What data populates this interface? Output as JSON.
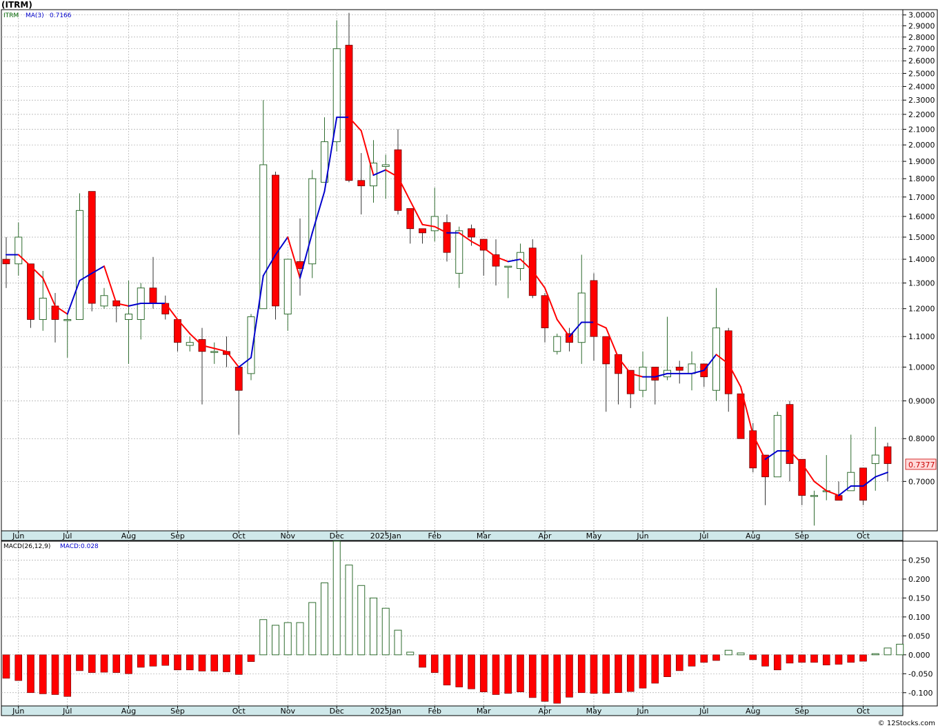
{
  "title": "(ITRM)",
  "credit": "© 12Stocks.com",
  "colors": {
    "up": "#2e6b2e",
    "down": "#ff0000",
    "down_wick": "#333333",
    "ma_up": "#0000cc",
    "ma_down": "#ff0000",
    "grid": "#aaaaaa",
    "axis_band": "#cfe8ea",
    "last_label_bg": "#ffd9d9",
    "last_label_fg": "#cc0000"
  },
  "chart_data": [
    {
      "type": "candlestick",
      "legend": {
        "symbol": "ITRM",
        "ma_label": "MA(3)",
        "ma_value": "0.7166"
      },
      "y_scale": "log",
      "ylim": [
        0.6,
        3.05
      ],
      "y_ticks": [
        {
          "v": 3.0,
          "label": "3.0000"
        },
        {
          "v": 2.9,
          "label": "2.9000"
        },
        {
          "v": 2.8,
          "label": "2.8000"
        },
        {
          "v": 2.7,
          "label": "2.7000"
        },
        {
          "v": 2.6,
          "label": "2.6000"
        },
        {
          "v": 2.5,
          "label": "2.5000"
        },
        {
          "v": 2.4,
          "label": "2.4000"
        },
        {
          "v": 2.3,
          "label": "2.3000"
        },
        {
          "v": 2.2,
          "label": "2.2000"
        },
        {
          "v": 2.1,
          "label": "2.1000"
        },
        {
          "v": 2.0,
          "label": "2.0000"
        },
        {
          "v": 1.9,
          "label": "1.9000"
        },
        {
          "v": 1.8,
          "label": "1.8000"
        },
        {
          "v": 1.7,
          "label": "1.7000"
        },
        {
          "v": 1.6,
          "label": "1.6000"
        },
        {
          "v": 1.5,
          "label": "1.5000"
        },
        {
          "v": 1.4,
          "label": "1.4000"
        },
        {
          "v": 1.3,
          "label": "1.3000"
        },
        {
          "v": 1.2,
          "label": "1.2000"
        },
        {
          "v": 1.1,
          "label": "1.1000"
        },
        {
          "v": 1.0,
          "label": "1.0000"
        },
        {
          "v": 0.9,
          "label": "0.9000"
        },
        {
          "v": 0.8,
          "label": "0.8000"
        },
        {
          "v": 0.7,
          "label": "0.7000"
        }
      ],
      "last_price": {
        "value": 0.7377,
        "label": "0.7377"
      },
      "months": [
        {
          "label": "Jun",
          "week": 1
        },
        {
          "label": "Jul",
          "week": 5
        },
        {
          "label": "Aug",
          "week": 10
        },
        {
          "label": "Sep",
          "week": 14
        },
        {
          "label": "Oct",
          "week": 19
        },
        {
          "label": "Nov",
          "week": 23
        },
        {
          "label": "Dec",
          "week": 27
        },
        {
          "label": "2025Jan",
          "week": 31
        },
        {
          "label": "Feb",
          "week": 35
        },
        {
          "label": "Mar",
          "week": 39
        },
        {
          "label": "Apr",
          "week": 44
        },
        {
          "label": "May",
          "week": 48
        },
        {
          "label": "Jun",
          "week": 52
        },
        {
          "label": "Jul",
          "week": 57
        },
        {
          "label": "Aug",
          "week": 61
        },
        {
          "label": "Sep",
          "week": 65
        },
        {
          "label": "Oct",
          "week": 70
        }
      ],
      "ohlc": [
        [
          1.4,
          1.5,
          1.28,
          1.38
        ],
        [
          1.38,
          1.57,
          1.33,
          1.5
        ],
        [
          1.38,
          1.38,
          1.13,
          1.16
        ],
        [
          1.16,
          1.35,
          1.12,
          1.24
        ],
        [
          1.21,
          1.26,
          1.08,
          1.16
        ],
        [
          1.16,
          1.18,
          1.03,
          1.16
        ],
        [
          1.16,
          1.72,
          1.16,
          1.63
        ],
        [
          1.73,
          1.73,
          1.19,
          1.22
        ],
        [
          1.21,
          1.28,
          1.2,
          1.25
        ],
        [
          1.23,
          1.23,
          1.15,
          1.21
        ],
        [
          1.16,
          1.31,
          1.01,
          1.18
        ],
        [
          1.16,
          1.3,
          1.09,
          1.28
        ],
        [
          1.28,
          1.41,
          1.2,
          1.22
        ],
        [
          1.22,
          1.25,
          1.16,
          1.18
        ],
        [
          1.16,
          1.16,
          1.05,
          1.08
        ],
        [
          1.07,
          1.1,
          1.05,
          1.08
        ],
        [
          1.09,
          1.13,
          0.89,
          1.05
        ],
        [
          1.05,
          1.08,
          1.01,
          1.05
        ],
        [
          1.05,
          1.1,
          1.0,
          1.04
        ],
        [
          1.0,
          1.0,
          0.81,
          0.93
        ],
        [
          0.98,
          1.18,
          0.96,
          1.17
        ],
        [
          1.2,
          2.3,
          1.2,
          1.88
        ],
        [
          1.82,
          1.84,
          1.16,
          1.21
        ],
        [
          1.18,
          1.38,
          1.12,
          1.4
        ],
        [
          1.39,
          1.59,
          1.25,
          1.36
        ],
        [
          1.38,
          1.85,
          1.32,
          1.8
        ],
        [
          1.78,
          2.18,
          1.78,
          2.02
        ],
        [
          2.02,
          2.95,
          1.96,
          2.7
        ],
        [
          2.73,
          3.02,
          1.78,
          1.79
        ],
        [
          1.79,
          1.95,
          1.61,
          1.76
        ],
        [
          1.76,
          2.03,
          1.67,
          1.89
        ],
        [
          1.87,
          1.94,
          1.69,
          1.88
        ],
        [
          1.97,
          2.1,
          1.61,
          1.63
        ],
        [
          1.64,
          1.64,
          1.47,
          1.54
        ],
        [
          1.54,
          1.54,
          1.47,
          1.52
        ],
        [
          1.53,
          1.75,
          1.48,
          1.6
        ],
        [
          1.57,
          1.61,
          1.39,
          1.43
        ],
        [
          1.34,
          1.55,
          1.28,
          1.53
        ],
        [
          1.54,
          1.56,
          1.46,
          1.5
        ],
        [
          1.49,
          1.49,
          1.33,
          1.44
        ],
        [
          1.42,
          1.49,
          1.29,
          1.37
        ],
        [
          1.37,
          1.37,
          1.24,
          1.37
        ],
        [
          1.36,
          1.47,
          1.31,
          1.43
        ],
        [
          1.45,
          1.49,
          1.24,
          1.25
        ],
        [
          1.25,
          1.26,
          1.08,
          1.13
        ],
        [
          1.05,
          1.11,
          1.04,
          1.1
        ],
        [
          1.11,
          1.13,
          1.05,
          1.08
        ],
        [
          1.08,
          1.42,
          1.01,
          1.26
        ],
        [
          1.31,
          1.34,
          1.02,
          1.1
        ],
        [
          1.1,
          1.1,
          0.87,
          1.01
        ],
        [
          1.04,
          1.04,
          0.89,
          0.98
        ],
        [
          0.99,
          0.99,
          0.88,
          0.92
        ],
        [
          0.93,
          1.05,
          0.91,
          1.0
        ],
        [
          1.0,
          1.0,
          0.89,
          0.96
        ],
        [
          0.97,
          1.17,
          0.96,
          0.99
        ],
        [
          1.0,
          1.02,
          0.95,
          0.99
        ],
        [
          0.98,
          1.05,
          0.93,
          1.01
        ],
        [
          1.01,
          1.01,
          0.94,
          0.97
        ],
        [
          0.93,
          1.28,
          0.9,
          1.13
        ],
        [
          1.12,
          1.13,
          0.87,
          0.92
        ],
        [
          0.92,
          0.92,
          0.8,
          0.8
        ],
        [
          0.82,
          0.84,
          0.72,
          0.73
        ],
        [
          0.76,
          0.76,
          0.65,
          0.71
        ],
        [
          0.71,
          0.87,
          0.71,
          0.86
        ],
        [
          0.89,
          0.9,
          0.7,
          0.74
        ],
        [
          0.75,
          0.75,
          0.65,
          0.67
        ],
        [
          0.67,
          0.68,
          0.61,
          0.67
        ],
        [
          0.68,
          0.76,
          0.66,
          0.68
        ],
        [
          0.67,
          0.7,
          0.66,
          0.66
        ],
        [
          0.68,
          0.81,
          0.68,
          0.72
        ],
        [
          0.73,
          0.73,
          0.65,
          0.66
        ],
        [
          0.74,
          0.83,
          0.68,
          0.76
        ],
        [
          0.78,
          0.79,
          0.7,
          0.74
        ]
      ],
      "ma": [
        1.42,
        1.42,
        1.37,
        1.32,
        1.21,
        1.18,
        1.31,
        1.34,
        1.37,
        1.22,
        1.21,
        1.22,
        1.22,
        1.22,
        1.16,
        1.11,
        1.07,
        1.06,
        1.05,
        1.0,
        1.03,
        1.33,
        1.42,
        1.5,
        1.32,
        1.52,
        1.73,
        2.18,
        2.18,
        2.09,
        1.82,
        1.85,
        1.81,
        1.68,
        1.56,
        1.55,
        1.52,
        1.52,
        1.48,
        1.45,
        1.41,
        1.39,
        1.4,
        1.35,
        1.28,
        1.16,
        1.1,
        1.15,
        1.15,
        1.13,
        1.03,
        0.98,
        0.97,
        0.97,
        0.98,
        0.98,
        0.98,
        0.99,
        1.04,
        1.01,
        0.94,
        0.81,
        0.75,
        0.77,
        0.77,
        0.74,
        0.7,
        0.68,
        0.67,
        0.69,
        0.69,
        0.71,
        0.72
      ]
    },
    {
      "type": "bar",
      "legend": {
        "indicator": "MACD(26,12,9)",
        "value_label": "MACD:0.028"
      },
      "ylim": [
        -0.135,
        0.3
      ],
      "y_ticks": [
        {
          "v": 0.25,
          "label": "0.250"
        },
        {
          "v": 0.2,
          "label": "0.200"
        },
        {
          "v": 0.15,
          "label": "0.150"
        },
        {
          "v": 0.1,
          "label": "0.100"
        },
        {
          "v": 0.05,
          "label": "0.050"
        },
        {
          "v": 0.0,
          "label": "0.000"
        },
        {
          "v": -0.05,
          "label": "-0.050"
        },
        {
          "v": -0.1,
          "label": "-0.100"
        }
      ],
      "values": [
        -0.062,
        -0.068,
        -0.1,
        -0.103,
        -0.105,
        -0.11,
        -0.042,
        -0.047,
        -0.046,
        -0.047,
        -0.05,
        -0.033,
        -0.03,
        -0.028,
        -0.04,
        -0.04,
        -0.043,
        -0.043,
        -0.045,
        -0.052,
        -0.018,
        0.093,
        0.078,
        0.085,
        0.085,
        0.138,
        0.19,
        0.3,
        0.237,
        0.183,
        0.15,
        0.123,
        0.065,
        0.007,
        -0.033,
        -0.047,
        -0.08,
        -0.085,
        -0.09,
        -0.098,
        -0.105,
        -0.102,
        -0.098,
        -0.113,
        -0.123,
        -0.128,
        -0.112,
        -0.1,
        -0.102,
        -0.102,
        -0.1,
        -0.097,
        -0.088,
        -0.075,
        -0.058,
        -0.042,
        -0.03,
        -0.02,
        -0.015,
        0.012,
        0.005,
        -0.013,
        -0.03,
        -0.04,
        -0.022,
        -0.02,
        -0.02,
        -0.027,
        -0.025,
        -0.02,
        -0.017,
        0.003,
        0.018,
        0.028
      ]
    }
  ]
}
